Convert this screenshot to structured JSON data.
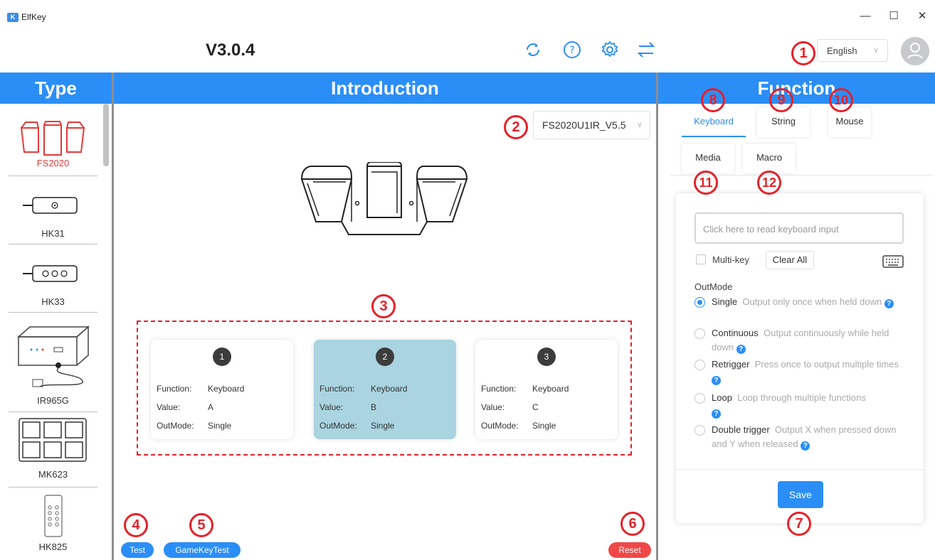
{
  "window": {
    "title": "ElfKey",
    "app_icon_glyph": "K",
    "minimize": "—",
    "maximize": "☐",
    "close": "✕"
  },
  "header": {
    "version": "V3.0.4",
    "language": "English"
  },
  "sections": {
    "type": "Type",
    "introduction": "Introduction",
    "function": "Function"
  },
  "sidebar": {
    "items": [
      {
        "label": "FS2020",
        "icon": "foot-pedal-3-icon",
        "active": true
      },
      {
        "label": "HK31",
        "icon": "single-key-device-icon"
      },
      {
        "label": "HK33",
        "icon": "three-key-device-icon"
      },
      {
        "label": "IR965G",
        "icon": "ir-sensor-box-icon"
      },
      {
        "label": "MK623",
        "icon": "six-key-pad-icon"
      },
      {
        "label": "HK825",
        "icon": "remote-control-icon"
      }
    ]
  },
  "middle": {
    "firmware": "FS2020U1IR_V5.5",
    "keys": [
      {
        "num": "1",
        "function_label": "Function:",
        "function": "Keyboard",
        "value_label": "Value:",
        "value": "A",
        "outmode_label": "OutMode:",
        "outmode": "Single"
      },
      {
        "num": "2",
        "function_label": "Function:",
        "function": "Keyboard",
        "value_label": "Value:",
        "value": "B",
        "outmode_label": "OutMode:",
        "outmode": "Single"
      },
      {
        "num": "3",
        "function_label": "Function:",
        "function": "Keyboard",
        "value_label": "Value:",
        "value": "C",
        "outmode_label": "OutMode:",
        "outmode": "Single"
      }
    ],
    "test_label": "Test",
    "gamekeytest_label": "GameKeyTest",
    "reset_label": "Reset"
  },
  "function_panel": {
    "tabs": [
      "Keyboard",
      "String",
      "Mouse",
      "Media",
      "Macro"
    ],
    "active_tab": "Keyboard",
    "input_placeholder": "Click here to read keyboard input",
    "multikey_label": "Multi-key",
    "clear_all_label": "Clear All",
    "outmode_title": "OutMode",
    "options": [
      {
        "name": "Single",
        "desc": "Output only once when held down",
        "selected": true
      },
      {
        "name": "Continuous",
        "desc": "Output continuously while held down"
      },
      {
        "name": "Retrigger",
        "desc": "Press once to output multiple times"
      },
      {
        "name": "Loop",
        "desc": "Loop through multiple functions"
      },
      {
        "name": "Double trigger",
        "desc": "Output X when pressed down and Y when released"
      }
    ],
    "help_glyph": "?",
    "save_label": "Save"
  },
  "annotations": [
    "1",
    "2",
    "3",
    "4",
    "5",
    "6",
    "7",
    "8",
    "9",
    "10",
    "11",
    "12"
  ],
  "colors": {
    "accent": "#2b8ef7",
    "annotation": "#e62129",
    "reset": "#f04848",
    "active_card": "#a9d4e0"
  }
}
